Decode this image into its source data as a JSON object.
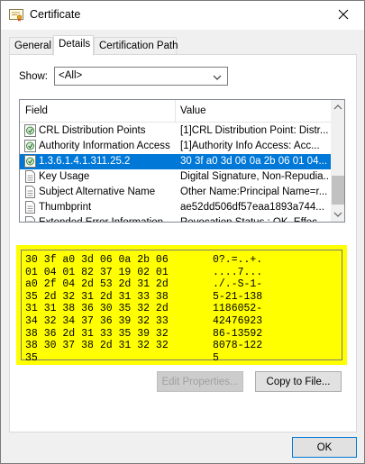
{
  "window": {
    "title": "Certificate"
  },
  "tabs": [
    {
      "label": "General"
    },
    {
      "label": "Details"
    },
    {
      "label": "Certification Path"
    }
  ],
  "show": {
    "label": "Show:",
    "value": "<All>"
  },
  "fields": {
    "col_field": "Field",
    "col_value": "Value",
    "rows": [
      {
        "name": "CRL Distribution Points",
        "value": "[1]CRL Distribution Point: Distr...",
        "icon": "certificate-extension-icon"
      },
      {
        "name": "Authority Information Access",
        "value": "[1]Authority Info Access: Acc...",
        "icon": "certificate-extension-icon"
      },
      {
        "name": "1.3.6.1.4.1.311.25.2",
        "value": "30 3f a0 3d 06 0a 2b 06 01 04...",
        "icon": "certificate-extension-icon"
      },
      {
        "name": "Key Usage",
        "value": "Digital Signature, Non-Repudia...",
        "icon": "document-icon"
      },
      {
        "name": "Subject Alternative Name",
        "value": "Other Name:Principal Name=r...",
        "icon": "document-icon"
      },
      {
        "name": "Thumbprint",
        "value": "ae52dd506df57eaa1893a744...",
        "icon": "document-icon"
      },
      {
        "name": "Extended Error Information",
        "value": "Revocation Status : OK. Effec...",
        "icon": "document-icon"
      }
    ],
    "selected_index": 2
  },
  "hex": {
    "highlight_color": "#ffff00",
    "lines": [
      {
        "hex": "30 3f a0 3d 06 0a 2b 06",
        "ascii": "0?.=..+."
      },
      {
        "hex": "01 04 01 82 37 19 02 01",
        "ascii": "....7..."
      },
      {
        "hex": "a0 2f 04 2d 53 2d 31 2d",
        "ascii": "./.-S-1-"
      },
      {
        "hex": "35 2d 32 31 2d 31 33 38",
        "ascii": "5-21-138"
      },
      {
        "hex": "31 31 38 36 30 35 32 2d",
        "ascii": "1186052-"
      },
      {
        "hex": "34 32 34 37 36 39 32 33",
        "ascii": "42476923"
      },
      {
        "hex": "38 36 2d 31 33 35 39 32",
        "ascii": "86-13592"
      },
      {
        "hex": "38 30 37 38 2d 31 32 32",
        "ascii": "8078-122"
      },
      {
        "hex": "35",
        "ascii": "5"
      }
    ]
  },
  "buttons": {
    "edit_properties": "Edit Properties...",
    "copy_to_file": "Copy to File...",
    "ok": "OK"
  },
  "colors": {
    "selection": "#0078d7",
    "accent_border": "#0078d7"
  }
}
